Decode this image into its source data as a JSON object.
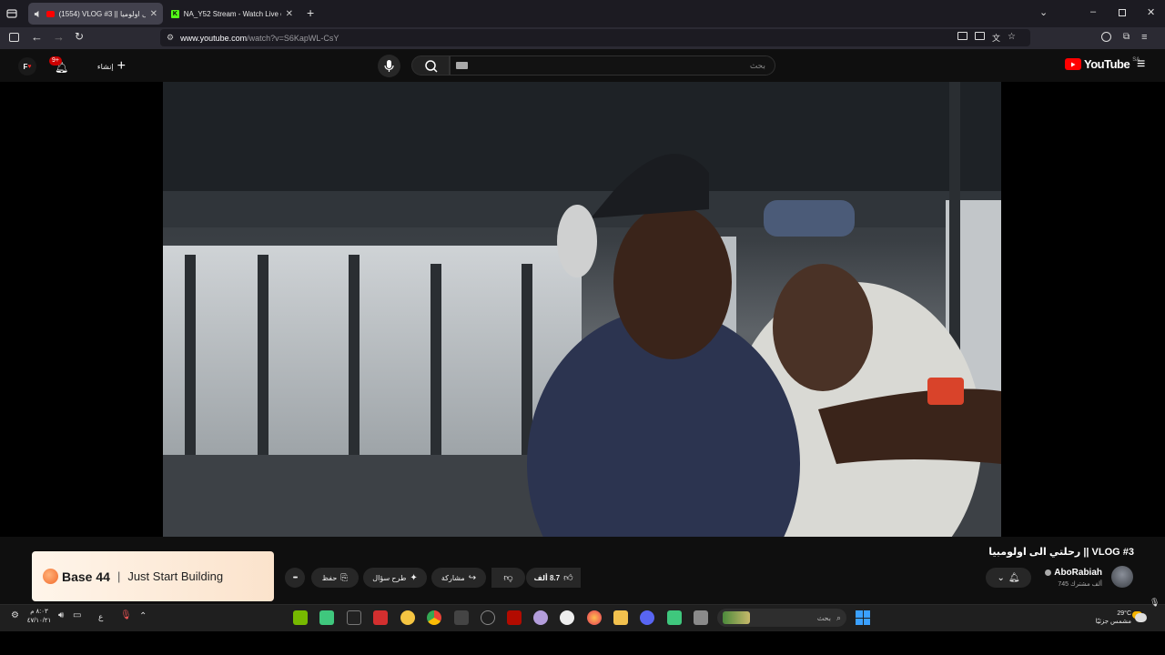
{
  "browser": {
    "tabs": [
      {
        "title": "(1554) VLOG #3 || رحلتي الى اولوميا",
        "active": true
      },
      {
        "title": "NA_Y52 Stream - Watch Live on",
        "active": false
      }
    ],
    "new_tab": "+",
    "url_host": "www.youtube.com",
    "url_path": "/watch?v=S6KapWL-CsY"
  },
  "youtube": {
    "logo_text": "YouTube",
    "region": "SA",
    "search_placeholder": "بحث",
    "create_label": "إنشاء",
    "notif_count": "9+",
    "avatar_text": "F"
  },
  "video": {
    "title": "رحلتي الى اولومبيا || VLOG #3",
    "channel_name": "AboRabiah",
    "subscribers": "745 ألف مشترك",
    "likes": "8.7 ألف",
    "share_label": "مشاركة",
    "ask_label": "طرح سؤال",
    "save_label": "حفظ",
    "more": "•••"
  },
  "ad": {
    "brand": "Base 44",
    "divider": "|",
    "tagline": "Just Start Building"
  },
  "taskbar": {
    "weather_temp": "29°C",
    "weather_desc": "مشمس جزئيًا",
    "search_placeholder": "بحث",
    "time": "٨:٠٣ م",
    "date": "٤٧/١٠/٢١",
    "lang": "ع"
  },
  "colors": {
    "yt_red": "#ff0000",
    "accent_green": "#1db954"
  }
}
